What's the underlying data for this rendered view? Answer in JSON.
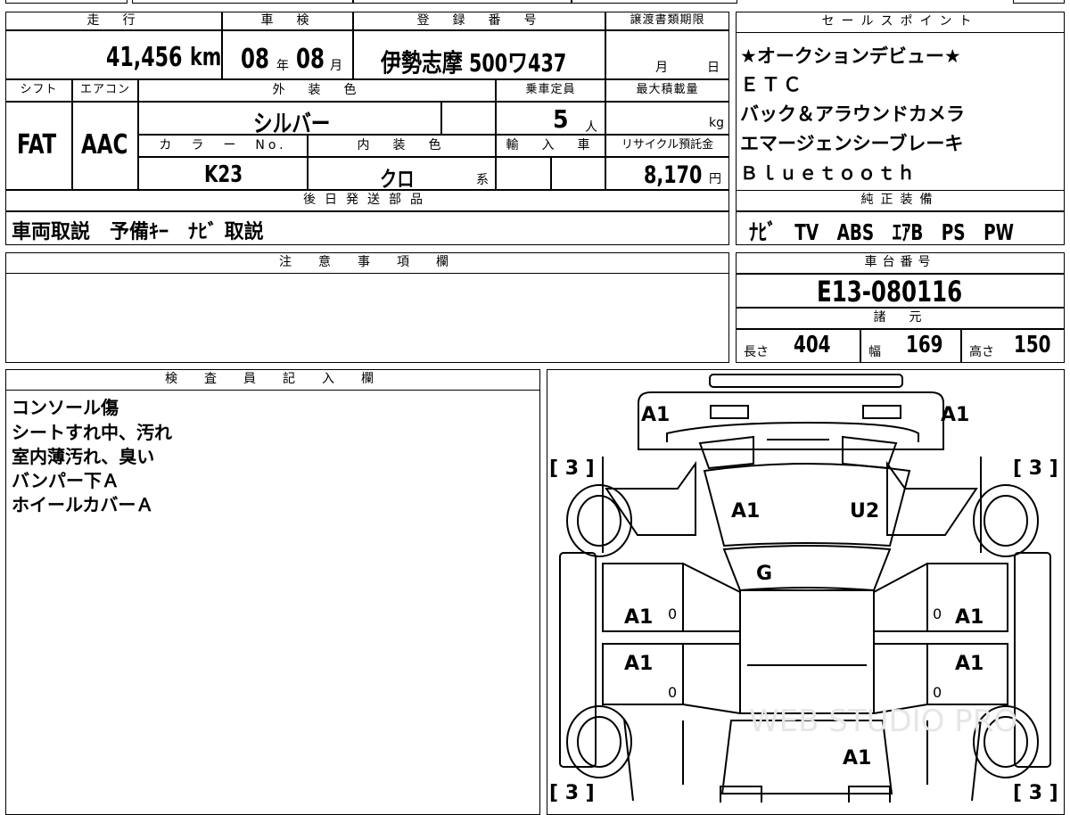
{
  "header": {
    "mileage": "走　行",
    "inspection": "車　検",
    "registration": "登　録　番　号",
    "transfer_deadline": "譲渡書類期限",
    "sales_points": "セールスポイント",
    "shift": "シフト",
    "aircon": "エアコン",
    "exterior_color": "外　装　色",
    "capacity": "乗車定員",
    "max_load": "最大積載量",
    "color_no": "カ　ラ　ー　No.",
    "interior_color": "内　装　色",
    "import": "輸　入　車",
    "recycle": "リサイクル預託金",
    "later_parts": "後日発送部品",
    "factory_equipment": "純正装備",
    "notes": "注　意　事　項　欄",
    "chassis_no": "車台番号",
    "specs": "諸　元",
    "inspector": "検　査　員　記　入　欄"
  },
  "values": {
    "mileage": "41,456",
    "mileage_unit": "km",
    "insp_year": "08",
    "insp_year_unit": "年",
    "insp_month": "08",
    "insp_month_unit": "月",
    "registration": "伊勢志摩 500ワ437",
    "deadline_month": "月",
    "deadline_day": "日",
    "shift": "FAT",
    "aircon": "AAC",
    "exterior_color": "シルバー",
    "capacity": "5",
    "capacity_unit": "人",
    "max_load_unit": "kg",
    "color_no": "K23",
    "interior_color": "クロ",
    "interior_suffix": "系",
    "recycle": "8,170",
    "recycle_unit": "円",
    "later_parts": "車両取説　予備ｷｰ　ﾅﾋﾞ 取説",
    "factory_equipment": "ﾅﾋﾞ　TV　ABS　ｴｱB　PS　PW",
    "chassis_no": "E13-080116",
    "length_label": "長さ",
    "length": "404",
    "width_label": "幅",
    "width": "169",
    "height_label": "高さ",
    "height": "150"
  },
  "sales_points": [
    "★オークションデビュー★",
    "ＥＴＣ",
    "バック＆アラウンドカメラ",
    "エマージェンシーブレーキ",
    "Ｂｌｕｅｔｏｏｔｈ"
  ],
  "inspector_remarks": [
    "コンソール傷",
    "シートすれ中、汚れ",
    "室内薄汚れ、臭い",
    "バンパー下Ａ",
    "ホイールカバーＡ"
  ],
  "diagram": {
    "front_left": "A1",
    "front_right": "A1",
    "hood_left": "A1",
    "hood_right": "U2",
    "windshield": "G",
    "front_door_left": "A1",
    "front_door_right": "A1",
    "rear_door_left": "A1",
    "rear_door_right": "A1",
    "roof_rear": "A1",
    "wheel_fl": "[ 3 ]",
    "wheel_fr": "[ 3 ]",
    "wheel_rl": "[ 3 ]",
    "wheel_rr": "[ 3 ]",
    "zero_fl": "0",
    "zero_rl": "0",
    "zero_fr": "0",
    "zero_rr": "0",
    "watermark": "WEB STUDIO PRO"
  }
}
